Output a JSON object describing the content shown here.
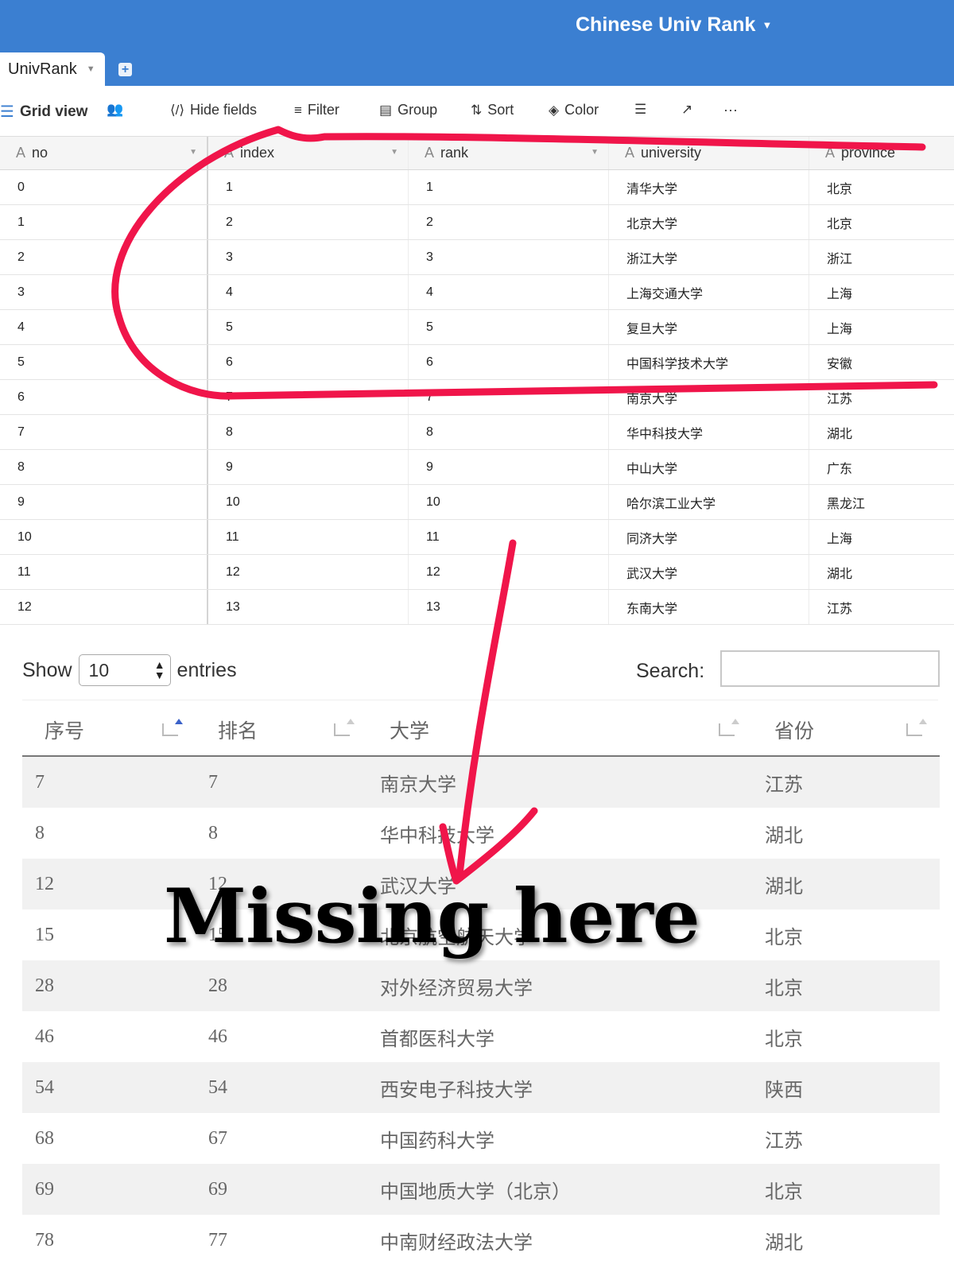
{
  "base": {
    "title": "Chinese Univ Rank"
  },
  "table_tab": {
    "label": "UnivRank"
  },
  "toolbar": {
    "view_label": "Grid view",
    "hide_fields": "Hide fields",
    "filter": "Filter",
    "group": "Group",
    "sort": "Sort",
    "color": "Color",
    "more": "···"
  },
  "grid": {
    "columns": [
      "no",
      "index",
      "rank",
      "university",
      "province"
    ],
    "rows": [
      [
        "0",
        "1",
        "1",
        "清华大学",
        "北京"
      ],
      [
        "1",
        "2",
        "2",
        "北京大学",
        "北京"
      ],
      [
        "2",
        "3",
        "3",
        "浙江大学",
        "浙江"
      ],
      [
        "3",
        "4",
        "4",
        "上海交通大学",
        "上海"
      ],
      [
        "4",
        "5",
        "5",
        "复旦大学",
        "上海"
      ],
      [
        "5",
        "6",
        "6",
        "中国科学技术大学",
        "安徽"
      ],
      [
        "6",
        "7",
        "7",
        "南京大学",
        "江苏"
      ],
      [
        "7",
        "8",
        "8",
        "华中科技大学",
        "湖北"
      ],
      [
        "8",
        "9",
        "9",
        "中山大学",
        "广东"
      ],
      [
        "9",
        "10",
        "10",
        "哈尔滨工业大学",
        "黑龙江"
      ],
      [
        "10",
        "11",
        "11",
        "同济大学",
        "上海"
      ],
      [
        "11",
        "12",
        "12",
        "武汉大学",
        "湖北"
      ],
      [
        "12",
        "13",
        "13",
        "东南大学",
        "江苏"
      ]
    ]
  },
  "datatable": {
    "show_label": "Show",
    "entries_value": "10",
    "entries_label": "entries",
    "search_label": "Search:",
    "search_value": "",
    "columns": [
      "序号",
      "排名",
      "大学",
      "省份"
    ],
    "rows": [
      [
        "7",
        "7",
        "南京大学",
        "江苏"
      ],
      [
        "8",
        "8",
        "华中科技大学",
        "湖北"
      ],
      [
        "12",
        "12",
        "武汉大学",
        "湖北"
      ],
      [
        "15",
        "15",
        "北京航空航天大学",
        "北京"
      ],
      [
        "28",
        "28",
        "对外经济贸易大学",
        "北京"
      ],
      [
        "46",
        "46",
        "首都医科大学",
        "北京"
      ],
      [
        "54",
        "54",
        "西安电子科技大学",
        "陕西"
      ],
      [
        "68",
        "67",
        "中国药科大学",
        "江苏"
      ],
      [
        "69",
        "69",
        "中国地质大学（北京）",
        "北京"
      ],
      [
        "78",
        "77",
        "中南财经政法大学",
        "湖北"
      ]
    ]
  },
  "annotation": {
    "text": "Missing here",
    "stroke_color": "#f0154a"
  }
}
